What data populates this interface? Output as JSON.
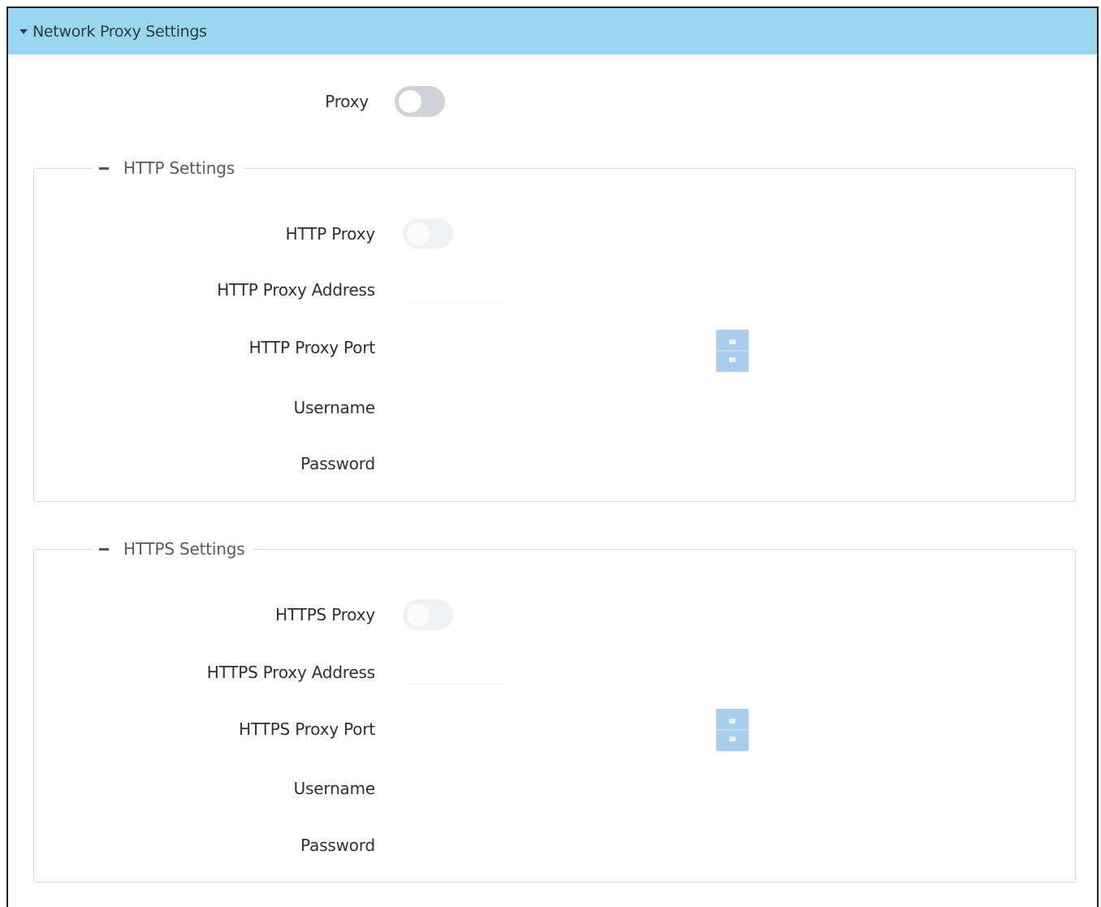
{
  "header": {
    "title": "Network Proxy Settings"
  },
  "proxy": {
    "label": "Proxy"
  },
  "http": {
    "legend": "HTTP Settings",
    "proxy_label": "HTTP Proxy",
    "address_label": "HTTP Proxy Address",
    "port_label": "HTTP Proxy Port",
    "username_label": "Username",
    "password_label": "Password"
  },
  "https": {
    "legend": "HTTPS Settings",
    "proxy_label": "HTTPS Proxy",
    "address_label": "HTTPS Proxy Address",
    "port_label": "HTTPS Proxy Port",
    "username_label": "Username",
    "password_label": "Password"
  },
  "colors": {
    "header_bg": "#9bd6f0",
    "spinner": "#a9cdec",
    "toggle_off": "#cfd3d6"
  },
  "icons": [
    "caret-down-icon",
    "minus-icon",
    "spinner-up-icon",
    "spinner-down-icon"
  ]
}
